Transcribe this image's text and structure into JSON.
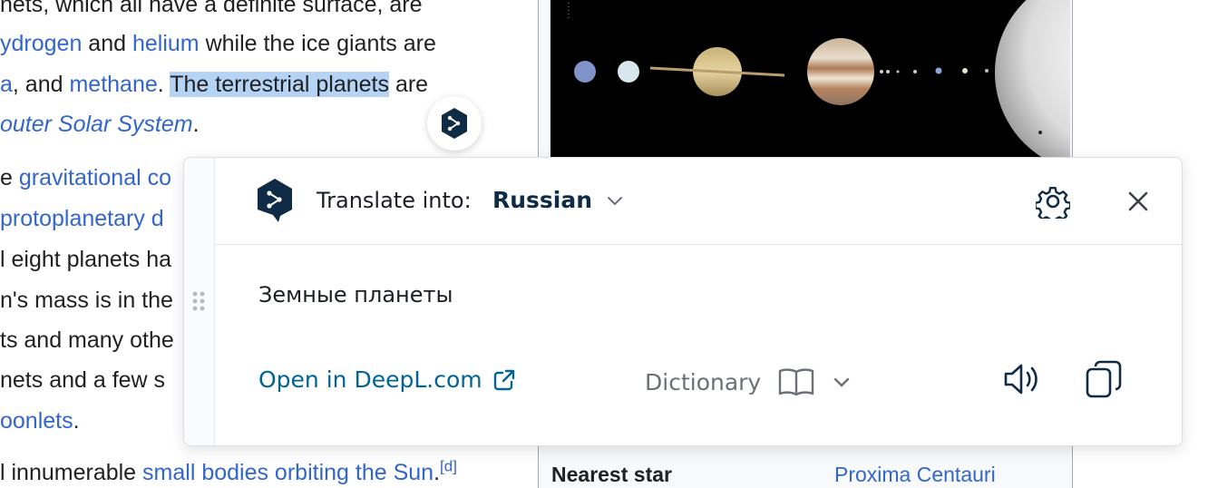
{
  "article": {
    "lines": [
      {
        "segments": [
          {
            "t": "nets, which all have a definite surface, are",
            "c": ""
          }
        ]
      },
      {
        "segments": [
          {
            "t": "ydrogen",
            "c": "lnk"
          },
          {
            "t": " and ",
            "c": ""
          },
          {
            "t": "helium",
            "c": "lnk"
          },
          {
            "t": " while the ice giants are",
            "c": ""
          }
        ]
      },
      {
        "segments": [
          {
            "t": "a",
            "c": "lnk"
          },
          {
            "t": ", and ",
            "c": ""
          },
          {
            "t": "methane",
            "c": "lnk"
          },
          {
            "t": ". ",
            "c": ""
          },
          {
            "t": "The terrestrial planets",
            "c": "sel"
          },
          {
            "t": " are",
            "c": ""
          }
        ]
      },
      {
        "segments": [
          {
            "t": " outer Solar System",
            "c": "lnk it"
          },
          {
            "t": ".",
            "c": ""
          }
        ]
      },
      {
        "segments": [
          {
            "t": "e ",
            "c": ""
          },
          {
            "t": "gravitational co",
            "c": "lnk"
          }
        ]
      },
      {
        "segments": [
          {
            "t": " protoplanetary d",
            "c": "lnk"
          }
        ]
      },
      {
        "segments": [
          {
            "t": "l eight planets ha",
            "c": ""
          }
        ]
      },
      {
        "segments": [
          {
            "t": "n's mass is in the",
            "c": ""
          }
        ]
      },
      {
        "segments": [
          {
            "t": "ts and many othe",
            "c": ""
          }
        ]
      },
      {
        "segments": [
          {
            "t": "nets and a few s",
            "c": ""
          }
        ]
      },
      {
        "segments": [
          {
            "t": "oonlets",
            "c": "lnk"
          },
          {
            "t": ".",
            "c": ""
          }
        ]
      },
      {
        "segments": [
          {
            "t": "l innumerable ",
            "c": ""
          },
          {
            "t": "small bodies orbiting the Sun",
            "c": "lnk"
          },
          {
            "t": ".",
            "c": ""
          },
          {
            "t": "[d]",
            "c": "lnk sup"
          }
        ]
      }
    ]
  },
  "infobox": {
    "nearest_star_label": "Nearest star",
    "nearest_star_value": "Proxima Centauri"
  },
  "popup": {
    "translate_label": "Translate into:",
    "language": "Russian",
    "translation": "Земные планеты",
    "open_link": "Open in DeepL.com",
    "dictionary": "Dictionary"
  },
  "colors": {
    "link": "#3366cc",
    "selection": "#b4d3f5",
    "deepl_navy": "#0f2b46",
    "deepl_link": "#006494"
  },
  "icons": [
    "deepl-logo-icon",
    "chevron-down-icon",
    "gear-icon",
    "close-icon",
    "drag-handle-icon",
    "external-link-icon",
    "book-icon",
    "speaker-icon",
    "copy-icon"
  ]
}
